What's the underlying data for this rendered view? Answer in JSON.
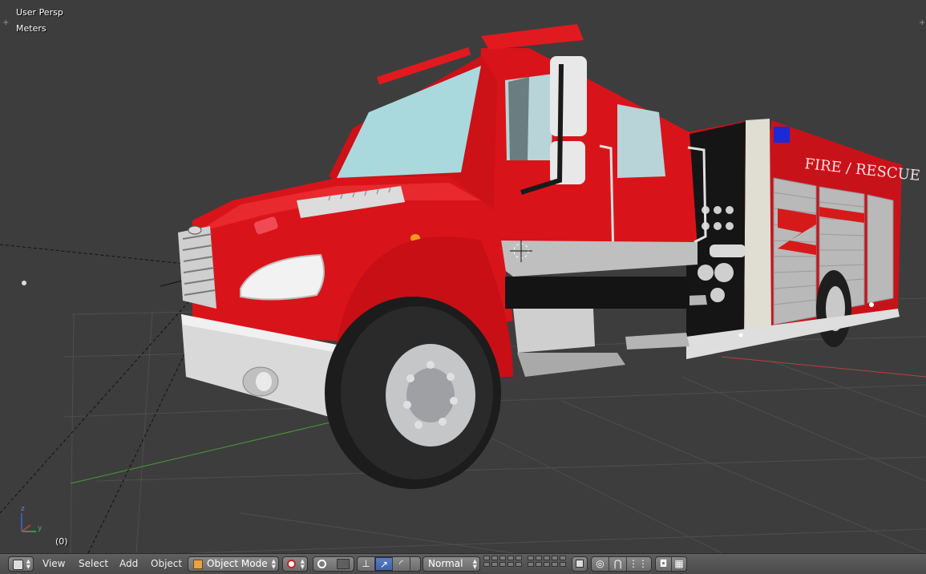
{
  "viewport": {
    "view_name": "User Persp",
    "units": "Meters",
    "frame": "(0)",
    "axis_x_label": "x",
    "axis_y_label": "y",
    "axis_z_label": "z",
    "object": {
      "side_text": "FIRE / RESCUE",
      "colors": {
        "body": "#d8141a",
        "chrome": "#d4d4d4",
        "tire": "#1f1f1f",
        "windshield": "#a9d9dc",
        "trim": "#bfbfbf"
      }
    }
  },
  "header": {
    "editor_type_icon": "3d-view-cube-icon",
    "menus": [
      "View",
      "Select",
      "Add",
      "Object"
    ],
    "mode": {
      "label": "Object Mode",
      "icon": "object-cube-icon"
    },
    "shading_icon": "solid-sphere-icon",
    "pivot_icon": "pivot-point-icon",
    "manipulator_icons": [
      "manipulator-toggle-icon",
      "translate-icon",
      "rotate-icon",
      "scale-icon"
    ],
    "orientation": "Normal",
    "proportional_icon": "proportional-edit-icon",
    "snap_icon": "magnet-icon",
    "render_icons": [
      "camera-render-icon",
      "clapper-render-icon"
    ]
  },
  "theme": {
    "viewport_bg": "#3d3d3d",
    "grid": "#4d4d4d",
    "x_axis": "#b0443e",
    "y_axis": "#4a9a3a",
    "active_blue": "#4a6fb5"
  }
}
